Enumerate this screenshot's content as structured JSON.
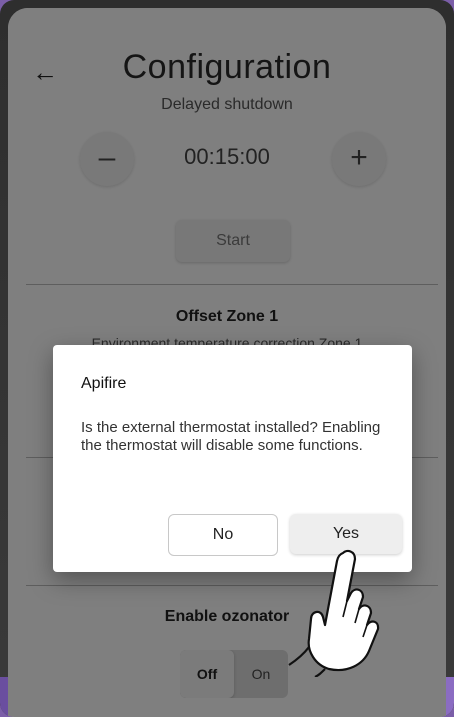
{
  "header": {
    "back_label": "←",
    "title": "Configuration"
  },
  "delayed_shutdown": {
    "label": "Delayed shutdown",
    "decrement_label": "–",
    "increment_label": "+",
    "time_value": "00:15:00",
    "start_label": "Start"
  },
  "offset_zone": {
    "title": "Offset Zone 1",
    "subtitle": "Environment temperature correction Zone 1"
  },
  "ozonator": {
    "title": "Enable ozonator",
    "off_label": "Off",
    "on_label": "On"
  },
  "dialog": {
    "title": "Apifire",
    "message": "Is the external thermostat installed? Enabling the thermostat will disable some functions.",
    "no_label": "No",
    "yes_label": "Yes"
  }
}
